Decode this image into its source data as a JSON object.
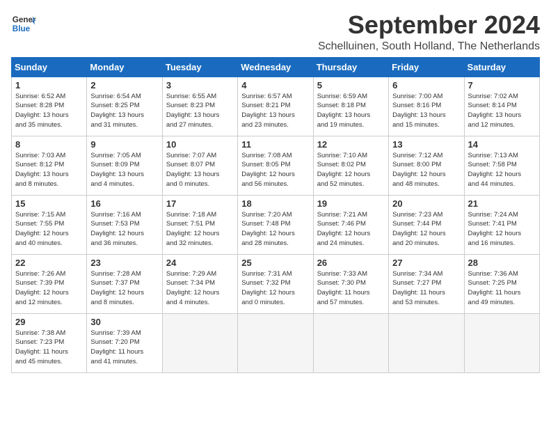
{
  "logo": {
    "line1": "General",
    "line2": "Blue"
  },
  "title": "September 2024",
  "subtitle": "Schelluinen, South Holland, The Netherlands",
  "days_of_week": [
    "Sunday",
    "Monday",
    "Tuesday",
    "Wednesday",
    "Thursday",
    "Friday",
    "Saturday"
  ],
  "weeks": [
    [
      {
        "day": "1",
        "info": "Sunrise: 6:52 AM\nSunset: 8:28 PM\nDaylight: 13 hours\nand 35 minutes."
      },
      {
        "day": "2",
        "info": "Sunrise: 6:54 AM\nSunset: 8:25 PM\nDaylight: 13 hours\nand 31 minutes."
      },
      {
        "day": "3",
        "info": "Sunrise: 6:55 AM\nSunset: 8:23 PM\nDaylight: 13 hours\nand 27 minutes."
      },
      {
        "day": "4",
        "info": "Sunrise: 6:57 AM\nSunset: 8:21 PM\nDaylight: 13 hours\nand 23 minutes."
      },
      {
        "day": "5",
        "info": "Sunrise: 6:59 AM\nSunset: 8:18 PM\nDaylight: 13 hours\nand 19 minutes."
      },
      {
        "day": "6",
        "info": "Sunrise: 7:00 AM\nSunset: 8:16 PM\nDaylight: 13 hours\nand 15 minutes."
      },
      {
        "day": "7",
        "info": "Sunrise: 7:02 AM\nSunset: 8:14 PM\nDaylight: 13 hours\nand 12 minutes."
      }
    ],
    [
      {
        "day": "8",
        "info": "Sunrise: 7:03 AM\nSunset: 8:12 PM\nDaylight: 13 hours\nand 8 minutes."
      },
      {
        "day": "9",
        "info": "Sunrise: 7:05 AM\nSunset: 8:09 PM\nDaylight: 13 hours\nand 4 minutes."
      },
      {
        "day": "10",
        "info": "Sunrise: 7:07 AM\nSunset: 8:07 PM\nDaylight: 13 hours\nand 0 minutes."
      },
      {
        "day": "11",
        "info": "Sunrise: 7:08 AM\nSunset: 8:05 PM\nDaylight: 12 hours\nand 56 minutes."
      },
      {
        "day": "12",
        "info": "Sunrise: 7:10 AM\nSunset: 8:02 PM\nDaylight: 12 hours\nand 52 minutes."
      },
      {
        "day": "13",
        "info": "Sunrise: 7:12 AM\nSunset: 8:00 PM\nDaylight: 12 hours\nand 48 minutes."
      },
      {
        "day": "14",
        "info": "Sunrise: 7:13 AM\nSunset: 7:58 PM\nDaylight: 12 hours\nand 44 minutes."
      }
    ],
    [
      {
        "day": "15",
        "info": "Sunrise: 7:15 AM\nSunset: 7:55 PM\nDaylight: 12 hours\nand 40 minutes."
      },
      {
        "day": "16",
        "info": "Sunrise: 7:16 AM\nSunset: 7:53 PM\nDaylight: 12 hours\nand 36 minutes."
      },
      {
        "day": "17",
        "info": "Sunrise: 7:18 AM\nSunset: 7:51 PM\nDaylight: 12 hours\nand 32 minutes."
      },
      {
        "day": "18",
        "info": "Sunrise: 7:20 AM\nSunset: 7:48 PM\nDaylight: 12 hours\nand 28 minutes."
      },
      {
        "day": "19",
        "info": "Sunrise: 7:21 AM\nSunset: 7:46 PM\nDaylight: 12 hours\nand 24 minutes."
      },
      {
        "day": "20",
        "info": "Sunrise: 7:23 AM\nSunset: 7:44 PM\nDaylight: 12 hours\nand 20 minutes."
      },
      {
        "day": "21",
        "info": "Sunrise: 7:24 AM\nSunset: 7:41 PM\nDaylight: 12 hours\nand 16 minutes."
      }
    ],
    [
      {
        "day": "22",
        "info": "Sunrise: 7:26 AM\nSunset: 7:39 PM\nDaylight: 12 hours\nand 12 minutes."
      },
      {
        "day": "23",
        "info": "Sunrise: 7:28 AM\nSunset: 7:37 PM\nDaylight: 12 hours\nand 8 minutes."
      },
      {
        "day": "24",
        "info": "Sunrise: 7:29 AM\nSunset: 7:34 PM\nDaylight: 12 hours\nand 4 minutes."
      },
      {
        "day": "25",
        "info": "Sunrise: 7:31 AM\nSunset: 7:32 PM\nDaylight: 12 hours\nand 0 minutes."
      },
      {
        "day": "26",
        "info": "Sunrise: 7:33 AM\nSunset: 7:30 PM\nDaylight: 11 hours\nand 57 minutes."
      },
      {
        "day": "27",
        "info": "Sunrise: 7:34 AM\nSunset: 7:27 PM\nDaylight: 11 hours\nand 53 minutes."
      },
      {
        "day": "28",
        "info": "Sunrise: 7:36 AM\nSunset: 7:25 PM\nDaylight: 11 hours\nand 49 minutes."
      }
    ],
    [
      {
        "day": "29",
        "info": "Sunrise: 7:38 AM\nSunset: 7:23 PM\nDaylight: 11 hours\nand 45 minutes."
      },
      {
        "day": "30",
        "info": "Sunrise: 7:39 AM\nSunset: 7:20 PM\nDaylight: 11 hours\nand 41 minutes."
      },
      {
        "day": "",
        "info": "",
        "empty": true
      },
      {
        "day": "",
        "info": "",
        "empty": true
      },
      {
        "day": "",
        "info": "",
        "empty": true
      },
      {
        "day": "",
        "info": "",
        "empty": true
      },
      {
        "day": "",
        "info": "",
        "empty": true
      }
    ]
  ]
}
